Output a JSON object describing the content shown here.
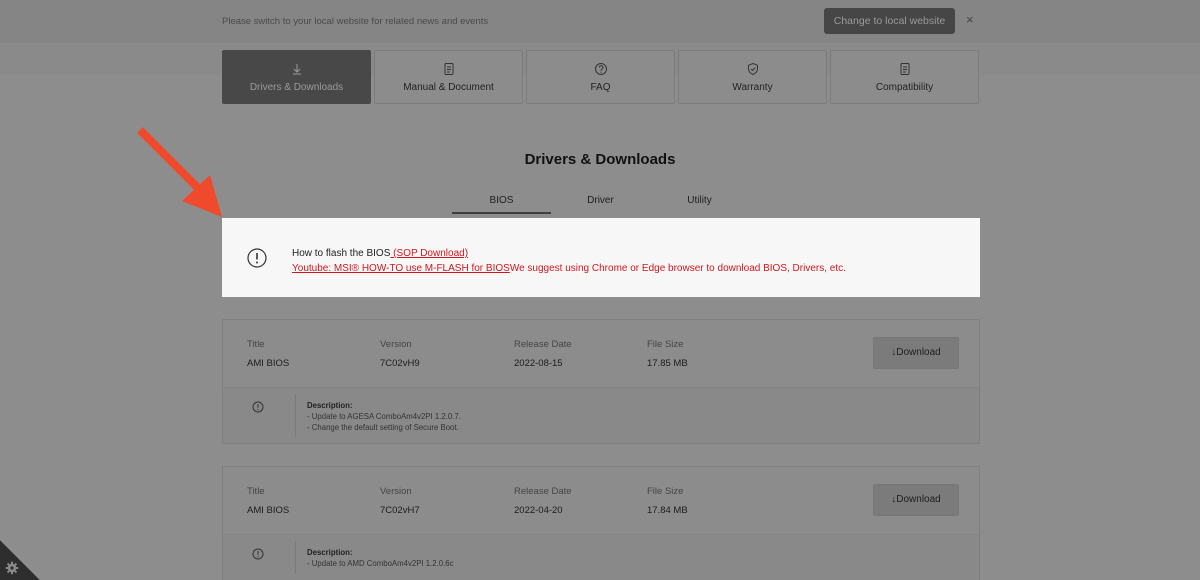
{
  "notice": {
    "text": "Please switch to your local website for related news and events",
    "button_label": "Change to local website",
    "close_label": "×"
  },
  "nav_tiles": [
    {
      "label": "Drivers & Downloads",
      "icon": "download-icon",
      "active": true
    },
    {
      "label": "Manual & Document",
      "icon": "document-icon",
      "active": false
    },
    {
      "label": "FAQ",
      "icon": "question-icon",
      "active": false
    },
    {
      "label": "Warranty",
      "icon": "shield-check-icon",
      "active": false
    },
    {
      "label": "Compatibility",
      "icon": "document-icon",
      "active": false
    }
  ],
  "section_title": "Drivers & Downloads",
  "subtabs": [
    {
      "label": "BIOS",
      "active": true
    },
    {
      "label": "Driver",
      "active": false
    },
    {
      "label": "Utility",
      "active": false
    }
  ],
  "alert": {
    "line1_text": "How to flash the BIOS",
    "line1_link": " (SOP Download)",
    "line2_link": "Youtube: MSI® HOW-TO use M-FLASH for BIOS",
    "line2_text": "We suggest using Chrome or Edge browser to download BIOS, Drivers, etc."
  },
  "columns": {
    "title": "Title",
    "version": "Version",
    "release_date": "Release Date",
    "file_size": "File Size"
  },
  "download_label": "Download",
  "description_heading": "Description:",
  "bios_items": [
    {
      "title": "AMI BIOS",
      "version": "7C02vH9",
      "release_date": "2022-08-15",
      "file_size": "17.85 MB",
      "description": [
        "- Update to AGESA ComboAm4v2PI 1.2.0.7.",
        "- Change the default setting of Secure Boot."
      ]
    },
    {
      "title": "AMI BIOS",
      "version": "7C02vH7",
      "release_date": "2022-04-20",
      "file_size": "17.84 MB",
      "description": [
        "- Update to AMD ComboAm4v2PI 1.2.0.6c"
      ]
    }
  ],
  "colors": {
    "accent_red": "#d2161e",
    "annotation_arrow": "#f04a2c",
    "active_tile": "#484848"
  }
}
